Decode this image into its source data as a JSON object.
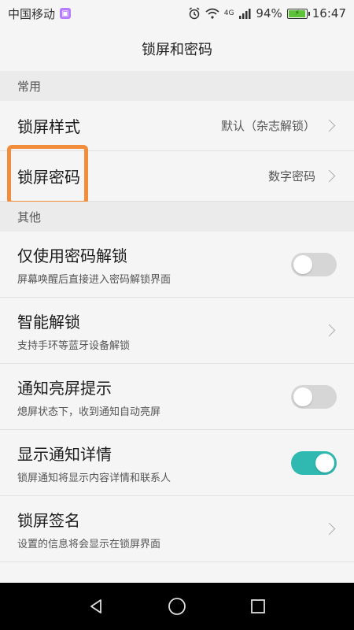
{
  "status_bar": {
    "carrier": "中国移动",
    "network": "4G",
    "battery": "94%",
    "time": "16:47",
    "icons": [
      "alarm-icon",
      "wifi-icon",
      "signal-icon",
      "battery-icon"
    ]
  },
  "title": "锁屏和密码",
  "sections": [
    {
      "header": "常用",
      "rows": [
        {
          "title": "锁屏样式",
          "value": "默认（杂志解锁）",
          "control": "chevron"
        },
        {
          "title": "锁屏密码",
          "value": "数字密码",
          "control": "chevron"
        }
      ]
    },
    {
      "header": "其他",
      "rows": [
        {
          "title": "仅使用密码解锁",
          "subtitle": "屏幕唤醒后直接进入密码解锁界面",
          "control": "toggle",
          "on": false
        },
        {
          "title": "智能解锁",
          "subtitle": "支持手环等蓝牙设备解锁",
          "control": "chevron"
        },
        {
          "title": "通知亮屏提示",
          "subtitle": "熄屏状态下，收到通知自动亮屏",
          "control": "toggle",
          "on": false
        },
        {
          "title": "显示通知详情",
          "subtitle": "锁屏通知将显示内容详情和联系人",
          "control": "toggle",
          "on": true
        },
        {
          "title": "锁屏签名",
          "subtitle": "设置的信息将会显示在锁屏界面",
          "control": "chevron"
        }
      ]
    }
  ],
  "colors": {
    "accent": "#2fb9b0",
    "highlight": "#f28d3b"
  },
  "nav": [
    "back-icon",
    "home-icon",
    "recents-icon"
  ]
}
